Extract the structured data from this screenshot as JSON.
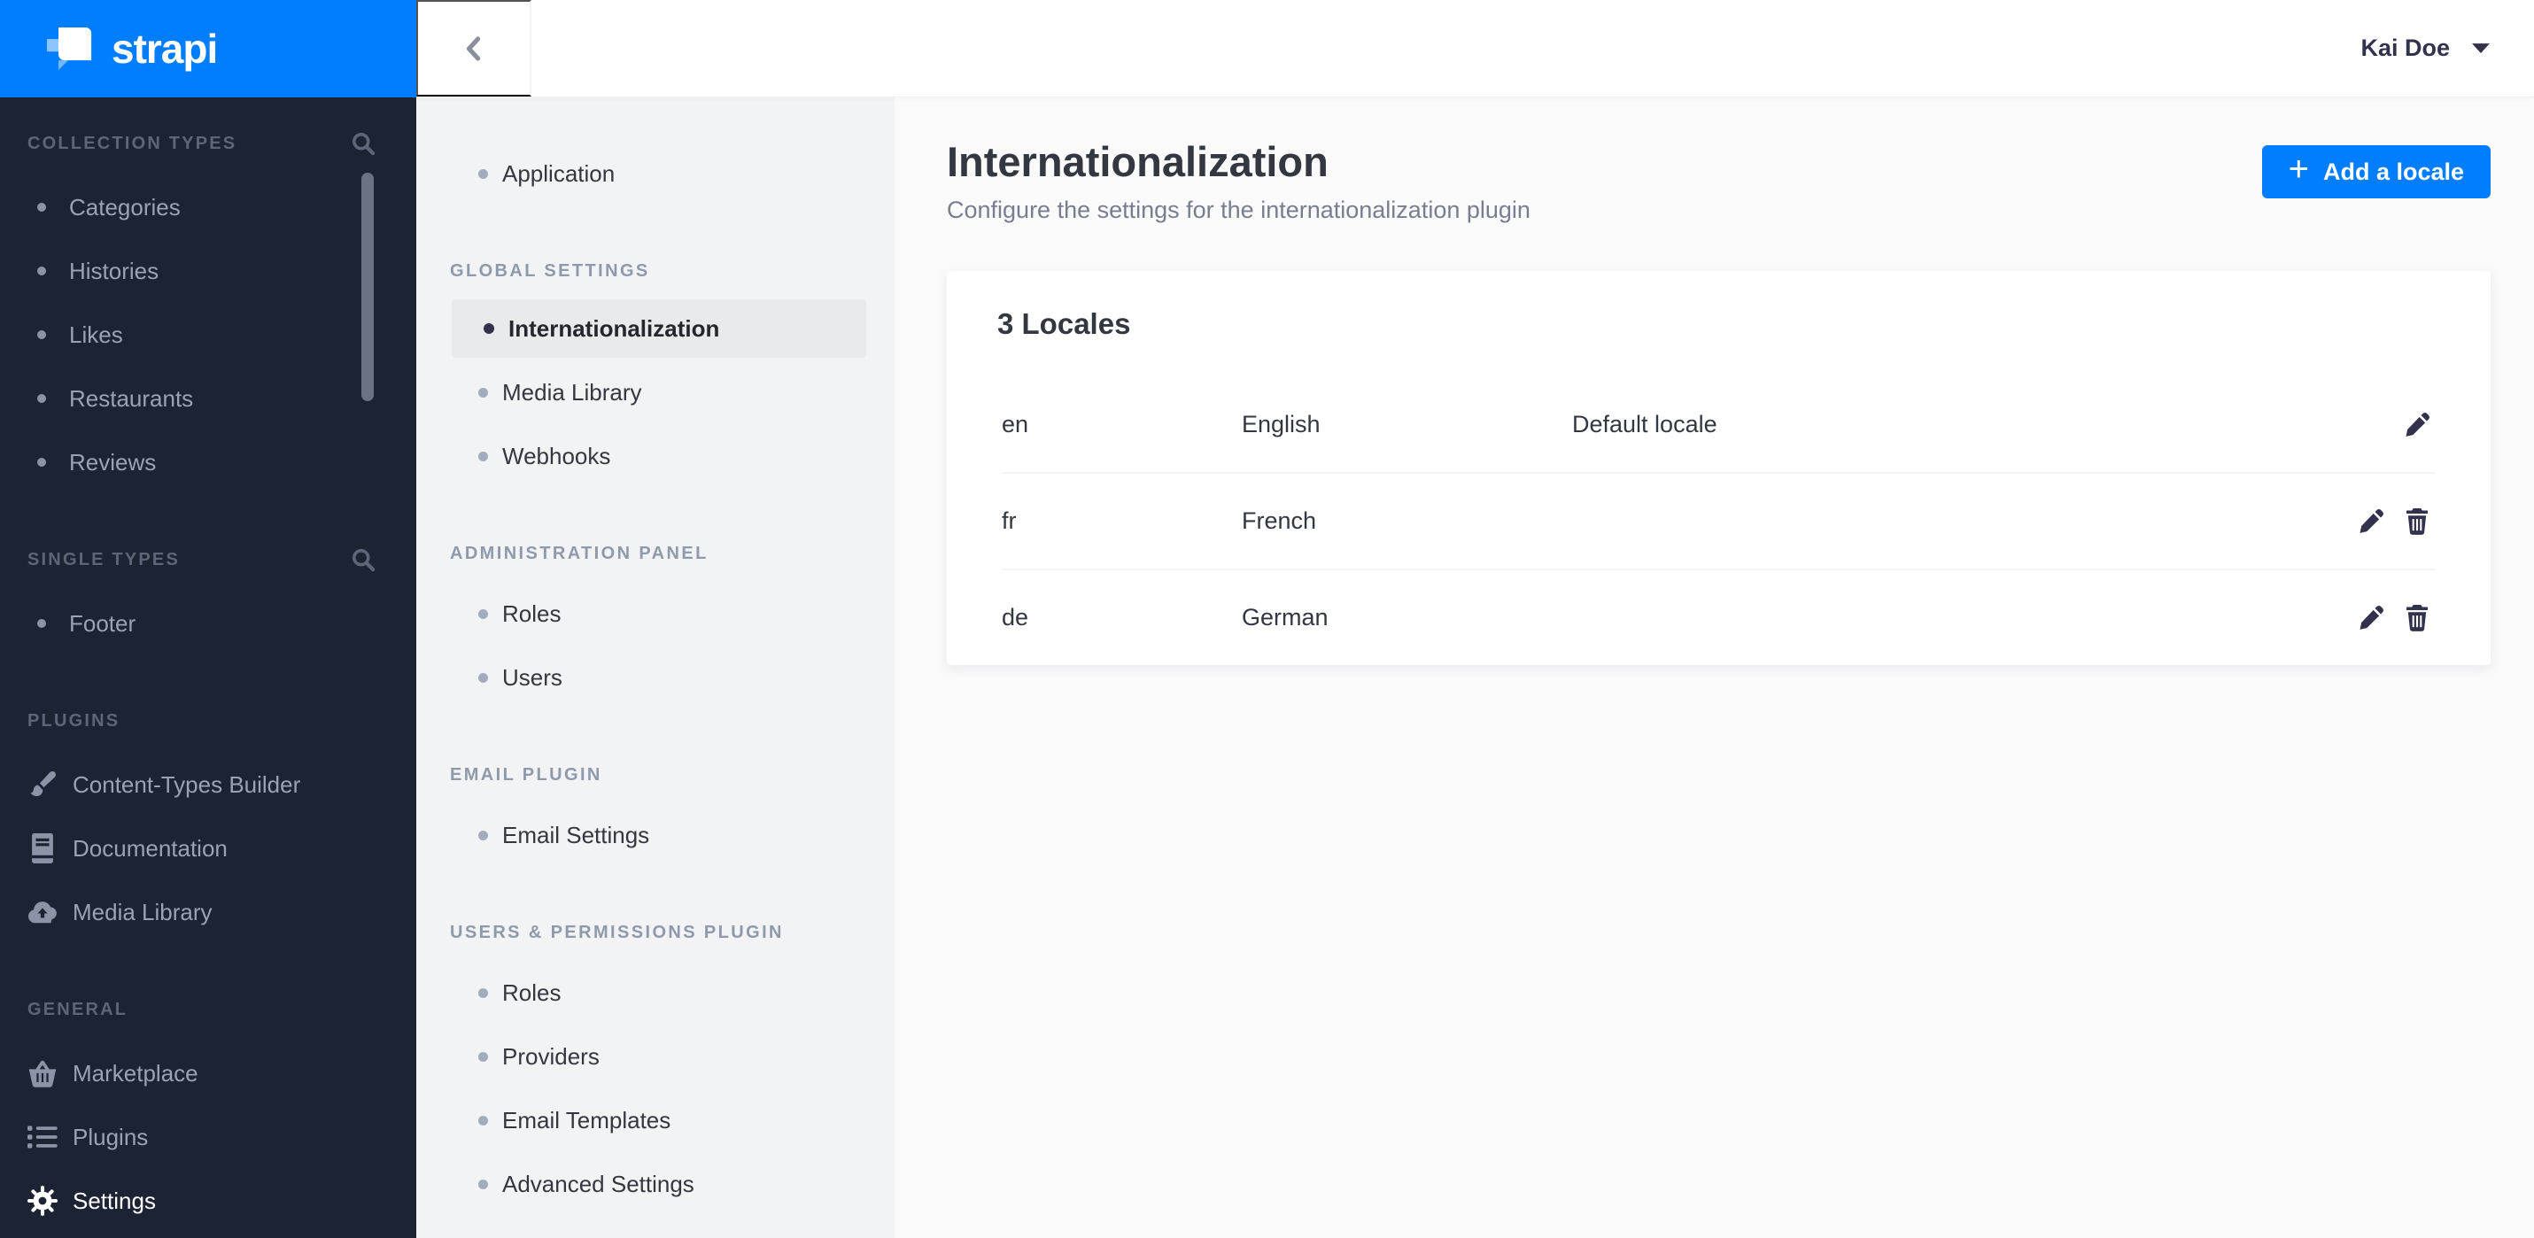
{
  "brand": {
    "name": "strapi",
    "logo_icon": "strapi-flag-icon"
  },
  "colors": {
    "accent_blue": "#007eff",
    "sidebar_bg": "#1c2333",
    "sidebar_text": "#9aa2b4",
    "settings_sidebar_bg": "#f2f3f4",
    "selected_item_bg": "#e9eaeb",
    "main_bg": "#fafafb",
    "card_bg": "#ffffff",
    "text_dark": "#333740",
    "text_muted": "#787e8f"
  },
  "main_sidebar": {
    "sections": [
      {
        "label": "COLLECTION TYPES",
        "search_icon": "search-icon",
        "items": [
          {
            "label": "Categories"
          },
          {
            "label": "Histories"
          },
          {
            "label": "Likes"
          },
          {
            "label": "Restaurants"
          },
          {
            "label": "Reviews"
          }
        ]
      },
      {
        "label": "SINGLE TYPES",
        "search_icon": "search-icon",
        "items": [
          {
            "label": "Footer"
          }
        ]
      },
      {
        "label": "PLUGINS",
        "items": [
          {
            "label": "Content-Types Builder",
            "icon": "brush-icon"
          },
          {
            "label": "Documentation",
            "icon": "book-icon"
          },
          {
            "label": "Media Library",
            "icon": "cloud-upload-icon"
          }
        ]
      },
      {
        "label": "GENERAL",
        "items": [
          {
            "label": "Marketplace",
            "icon": "basket-icon"
          },
          {
            "label": "Plugins",
            "icon": "list-icon"
          },
          {
            "label": "Settings",
            "icon": "gear-icon",
            "active": true
          }
        ]
      }
    ]
  },
  "topbar": {
    "back_icon": "chevron-left-icon",
    "user_name": "Kai Doe",
    "user_caret_icon": "caret-down-icon"
  },
  "settings_sidebar": {
    "top_item": {
      "label": "Application"
    },
    "sections": [
      {
        "label": "GLOBAL SETTINGS",
        "items": [
          {
            "label": "Internationalization",
            "selected": true
          },
          {
            "label": "Media Library"
          },
          {
            "label": "Webhooks"
          }
        ]
      },
      {
        "label": "ADMINISTRATION PANEL",
        "items": [
          {
            "label": "Roles"
          },
          {
            "label": "Users"
          }
        ]
      },
      {
        "label": "EMAIL PLUGIN",
        "items": [
          {
            "label": "Email Settings"
          }
        ]
      },
      {
        "label": "USERS & PERMISSIONS PLUGIN",
        "items": [
          {
            "label": "Roles"
          },
          {
            "label": "Providers"
          },
          {
            "label": "Email Templates"
          },
          {
            "label": "Advanced Settings"
          }
        ]
      }
    ]
  },
  "page": {
    "title": "Internationalization",
    "subtitle": "Configure the settings for the internationalization plugin",
    "add_button_label": "Add a locale",
    "add_button_icon": "plus-icon"
  },
  "locales_card": {
    "title": "3 Locales",
    "rows": [
      {
        "code": "en",
        "name": "English",
        "note": "Default locale",
        "actions": [
          "edit-pencil-icon"
        ]
      },
      {
        "code": "fr",
        "name": "French",
        "note": "",
        "actions": [
          "edit-pencil-icon",
          "trash-icon"
        ]
      },
      {
        "code": "de",
        "name": "German",
        "note": "",
        "actions": [
          "edit-pencil-icon",
          "trash-icon"
        ]
      }
    ]
  }
}
